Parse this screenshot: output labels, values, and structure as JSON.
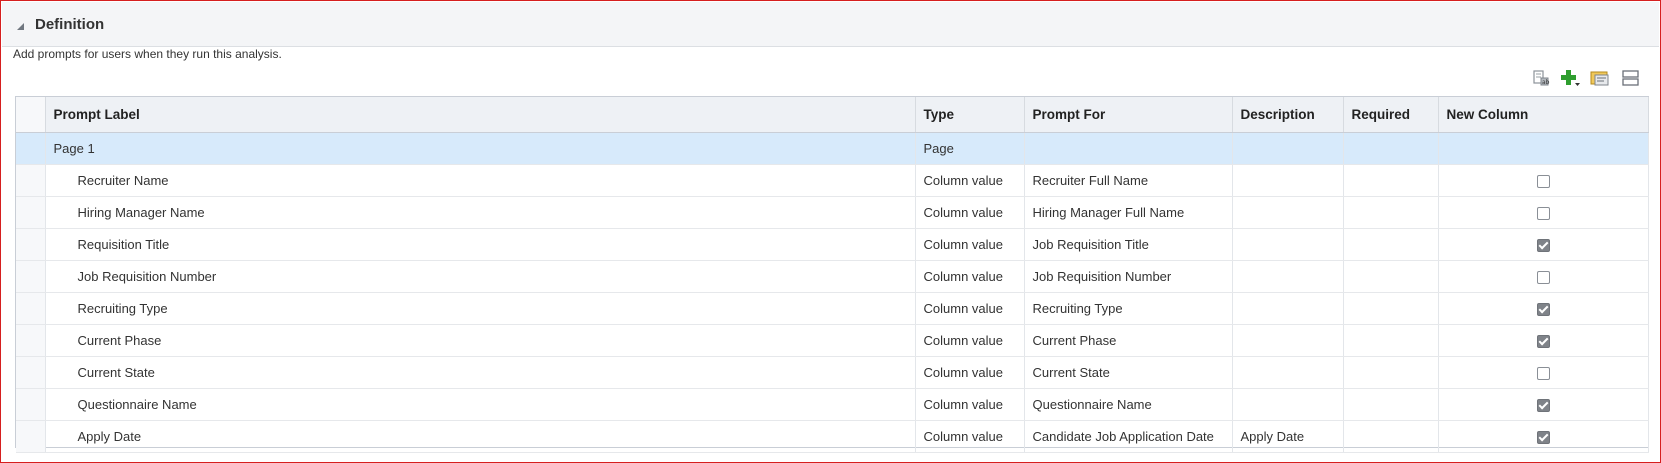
{
  "section": {
    "title": "Definition",
    "description": "Add prompts for users when they run this analysis."
  },
  "toolbar": {
    "icons": [
      "edit-prompt-icon",
      "add-prompt-icon",
      "page-settings-icon",
      "layout-icon"
    ],
    "add_color": "#2f9e2f"
  },
  "table": {
    "columns": [
      "Prompt Label",
      "Type",
      "Prompt For",
      "Description",
      "Required",
      "New Column"
    ],
    "rows": [
      {
        "label": "Page 1",
        "type": "Page",
        "prompt_for": "",
        "description": "",
        "required": "",
        "new_column": null,
        "page": true
      },
      {
        "label": "Recruiter Name",
        "type": "Column value",
        "prompt_for": "Recruiter Full Name",
        "description": "",
        "required": "",
        "new_column": false
      },
      {
        "label": "Hiring Manager Name",
        "type": "Column value",
        "prompt_for": "Hiring Manager Full Name",
        "description": "",
        "required": "",
        "new_column": false
      },
      {
        "label": "Requisition Title",
        "type": "Column value",
        "prompt_for": "Job Requisition Title",
        "description": "",
        "required": "",
        "new_column": true
      },
      {
        "label": "Job Requisition Number",
        "type": "Column value",
        "prompt_for": "Job Requisition Number",
        "description": "",
        "required": "",
        "new_column": false
      },
      {
        "label": "Recruiting Type",
        "type": "Column value",
        "prompt_for": "Recruiting Type",
        "description": "",
        "required": "",
        "new_column": true
      },
      {
        "label": "Current Phase",
        "type": "Column value",
        "prompt_for": "Current Phase",
        "description": "",
        "required": "",
        "new_column": true
      },
      {
        "label": "Current State",
        "type": "Column value",
        "prompt_for": "Current State",
        "description": "",
        "required": "",
        "new_column": false
      },
      {
        "label": "Questionnaire Name",
        "type": "Column value",
        "prompt_for": "Questionnaire Name",
        "description": "",
        "required": "",
        "new_column": true
      },
      {
        "label": "Apply Date",
        "type": "Column value",
        "prompt_for": "Candidate Job Application Date",
        "description": "Apply Date",
        "required": "",
        "new_column": true
      }
    ]
  },
  "colors": {
    "frame_border": "#d61f1f",
    "header_bg": "#eef1f5",
    "selected_row": "#d7eafb"
  }
}
